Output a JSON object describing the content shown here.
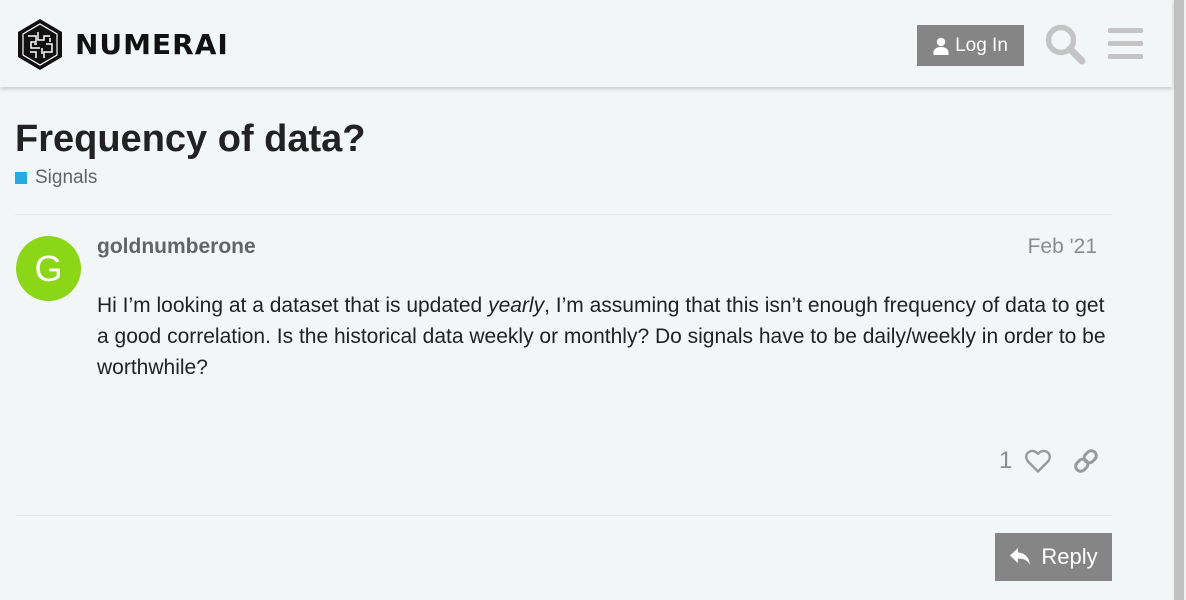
{
  "header": {
    "brand": "NUMERAI",
    "login_label": "Log In"
  },
  "topic": {
    "title": "Frequency of data?",
    "category": "Signals",
    "category_color": "#25aae1"
  },
  "post": {
    "avatar_letter": "G",
    "avatar_color": "#8bd617",
    "username": "goldnumberone",
    "date": "Feb '21",
    "body_before": "Hi I’m looking at a dataset that is updated ",
    "body_emphasis": "yearly",
    "body_after": ", I’m assuming that this isn’t enough frequency of data to get a good correlation. Is the historical data weekly or monthly? Do signals have to be daily/weekly in order to be worthwhile?",
    "like_count": "1"
  },
  "footer": {
    "reply_label": "Reply"
  },
  "icons": [
    "numerai-logo",
    "user-icon",
    "search-icon",
    "hamburger-menu-icon",
    "heart-icon",
    "link-icon",
    "reply-icon"
  ]
}
